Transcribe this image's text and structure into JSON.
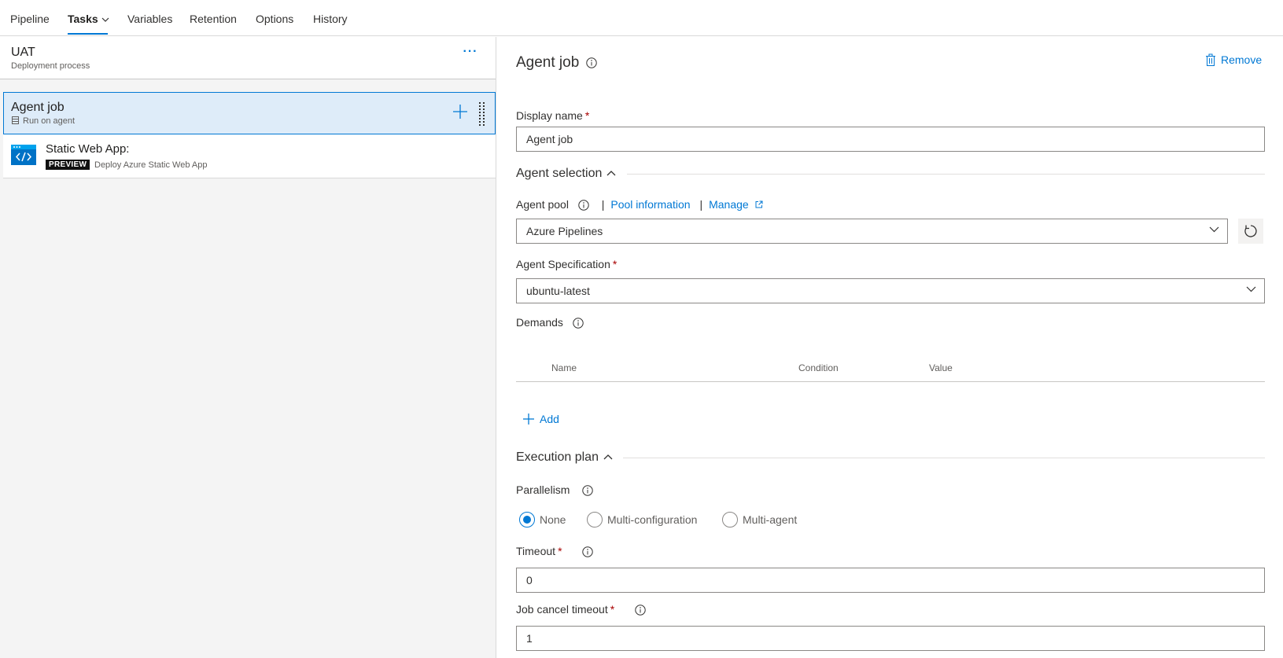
{
  "tabs": [
    {
      "label": "Pipeline"
    },
    {
      "label": "Tasks"
    },
    {
      "label": "Variables"
    },
    {
      "label": "Retention"
    },
    {
      "label": "Options"
    },
    {
      "label": "History"
    }
  ],
  "left": {
    "stage": {
      "title": "UAT",
      "subtitle": "Deployment process",
      "more": "···"
    },
    "job": {
      "title": "Agent job",
      "subtitle": "Run on agent"
    },
    "task": {
      "title": "Static Web App:",
      "badge": "PREVIEW",
      "subtitle": "Deploy Azure Static Web App"
    }
  },
  "right": {
    "title": "Agent job",
    "remove_label": "Remove",
    "display_name": {
      "label": "Display name",
      "required": "*",
      "value": "Agent job"
    },
    "agent_selection": {
      "label": "Agent selection"
    },
    "agent_pool": {
      "label": "Agent pool",
      "pool_info_link": "Pool information",
      "manage_link": "Manage",
      "sep": "|",
      "value": "Azure Pipelines"
    },
    "agent_spec": {
      "label": "Agent Specification",
      "required": "*",
      "value": "ubuntu-latest"
    },
    "demands": {
      "label": "Demands",
      "columns": [
        "Name",
        "Condition",
        "Value"
      ],
      "add_label": "Add"
    },
    "execution_plan": {
      "label": "Execution plan"
    },
    "parallelism": {
      "label": "Parallelism",
      "options": [
        "None",
        "Multi-configuration",
        "Multi-agent"
      ],
      "selected": "None"
    },
    "timeout": {
      "label": "Timeout",
      "required": "*",
      "value": "0"
    },
    "cancel_timeout": {
      "label": "Job cancel timeout",
      "required": "*",
      "value": "1"
    }
  },
  "colors": {
    "accent": "#0078d4",
    "selected_bg": "#deecf9",
    "required": "#a80000"
  }
}
